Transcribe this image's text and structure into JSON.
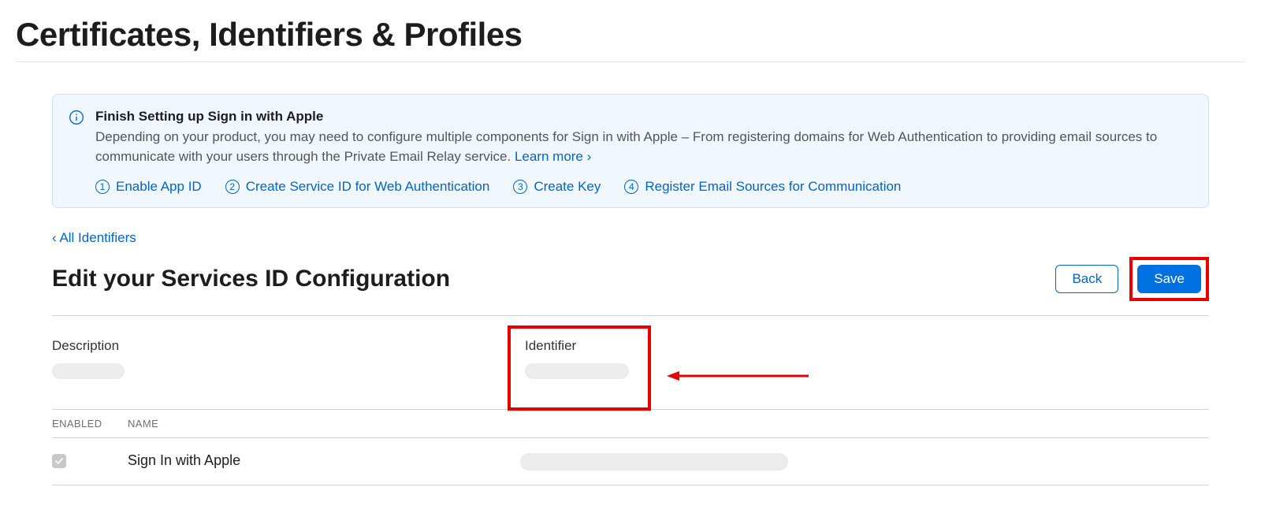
{
  "page": {
    "title": "Certificates, Identifiers & Profiles"
  },
  "info": {
    "title": "Finish Setting up Sign in with Apple",
    "body_pre_link": "Depending on your product, you may need to configure multiple components for Sign in with Apple – From registering domains for Web Authentication to providing email sources to communicate with your users through the Private Email Relay service. ",
    "learn_more": "Learn more ›",
    "steps": [
      {
        "num": "1",
        "label": "Enable App ID"
      },
      {
        "num": "2",
        "label": "Create Service ID for Web Authentication"
      },
      {
        "num": "3",
        "label": "Create Key"
      },
      {
        "num": "4",
        "label": "Register Email Sources for Communication"
      }
    ]
  },
  "breadcrumb": {
    "back": "‹ All Identifiers"
  },
  "section": {
    "title": "Edit your Services ID Configuration",
    "back_label": "Back",
    "save_label": "Save"
  },
  "fields": {
    "description_label": "Description",
    "identifier_label": "Identifier"
  },
  "capabilities": {
    "col_enabled": "Enabled",
    "col_name": "Name",
    "rows": [
      {
        "enabled": true,
        "name": "Sign In with Apple"
      }
    ]
  }
}
